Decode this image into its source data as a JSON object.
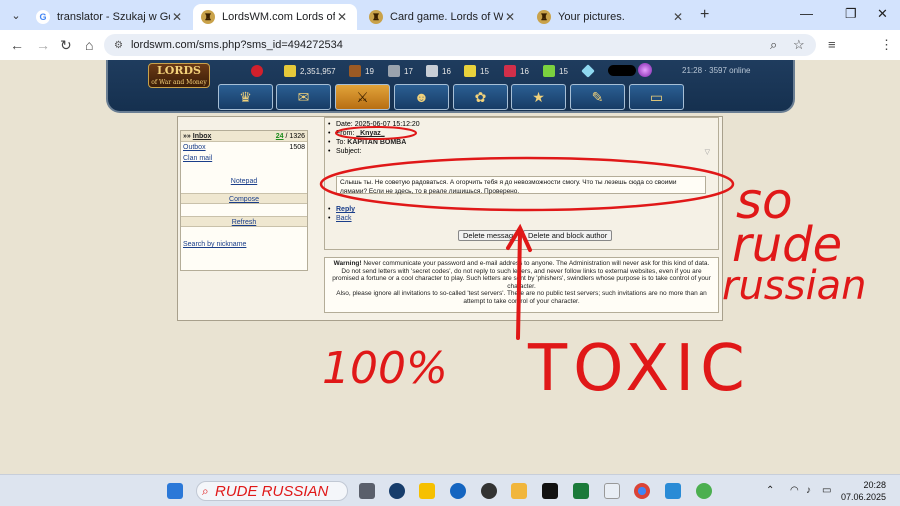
{
  "browser": {
    "tabs": [
      {
        "title": "translator - Szukaj w Google",
        "favicon": "google-icon"
      },
      {
        "title": "LordsWM.com Lords of War and Money",
        "favicon": "lordswm-icon"
      },
      {
        "title": "Card game. Lords of War and M",
        "favicon": "lordswm-icon"
      },
      {
        "title": "Your pictures.",
        "favicon": "lordswm-icon"
      }
    ],
    "url": "lordswm.com/sms.php?sms_id=494272534"
  },
  "game": {
    "logo_line1": "LORDS",
    "logo_line2": "of War and Money",
    "resources": [
      "2,351,957",
      "19",
      "17",
      "16",
      "15",
      "16",
      "15"
    ],
    "server_time": "21:28 · 3597 online",
    "nav_icons": [
      "home-icon",
      "map-icon",
      "battle-icon",
      "character-icon",
      "market-icon",
      "castle-icon",
      "scroll-icon",
      "chat-icon"
    ]
  },
  "sidebar": {
    "inbox_prefix": "»»",
    "inbox_label": "Inbox",
    "inbox_unread": "24",
    "inbox_total": "/ 1326",
    "outbox_label": "Outbox",
    "outbox_count": "1508",
    "clan_mail": "Clan mail",
    "notepad": "Notepad",
    "compose": "Compose",
    "refresh": "Refresh",
    "search_by_nickname": "Search by nickname"
  },
  "message": {
    "date_label": "Date:",
    "date": "2025-06-07 15:12:20",
    "from_label": "From:",
    "from": "_Knyaz_",
    "to_label": "To:",
    "to": "KAPITAN BOMBA",
    "subject_label": "Subject:",
    "subject": "",
    "body": "Слышь ты. Не советую радоваться. А огорчить тебя я до невозможности смогу. Что ты лезешь сюда со своими лямами? Если не здесь, то в реале лишишься. Проверено.",
    "reply": "Reply",
    "back": "Back",
    "delete_button": "Delete message",
    "delete_block_button": "Delete and block author"
  },
  "warning": {
    "title": "Warning!",
    "text": "Never communicate your password and e-mail address to anyone. The Administration will never ask for this kind of data. Do not send letters with 'secret codes', do not reply to such letters, and never follow links to external websites, even if you are promised a fortune or a cool character to play. Such letters are sent by 'phishers', swindlers whose purpose is to take control of your character.",
    "text2": "Also, please ignore all invitations to so-called 'test servers'. There are no public test servers; such invitations are no more than an attempt to take control of your character."
  },
  "annotations": {
    "so": "so",
    "rude": "rude",
    "russian": "russian",
    "hundred": "100%",
    "toxic": "TOXIC",
    "color": "#e01818"
  },
  "taskbar": {
    "search_text": "RUDE RUSSIAN",
    "time": "20:28",
    "date": "07.06.2025"
  }
}
